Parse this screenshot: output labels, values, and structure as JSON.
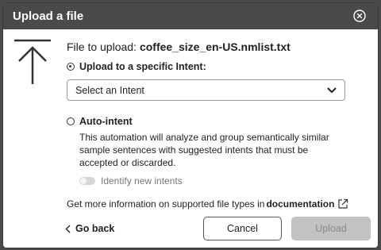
{
  "dialog": {
    "title": "Upload a file",
    "close_icon": "close-circle-icon"
  },
  "file": {
    "prefix": "File to upload:",
    "name": "coffee_size_en-US.nmlist.txt"
  },
  "options": {
    "specific_intent": {
      "label": "Upload to a specific Intent:",
      "selected": true
    },
    "select": {
      "value": "Select an Intent"
    },
    "auto_intent": {
      "label": "Auto-intent",
      "selected": false,
      "description": "This automation will analyze and group semantically similar sample sentences with suggested intents that must be accepted or discarded.",
      "toggle_label": "Identify new intents",
      "toggle_on": false
    }
  },
  "info": {
    "text": "Get more information on supported file types in",
    "link_label": "documentation",
    "link_icon": "external-link-icon"
  },
  "footer": {
    "back_label": "Go back",
    "cancel_label": "Cancel",
    "upload_label": "Upload",
    "upload_disabled": true
  }
}
